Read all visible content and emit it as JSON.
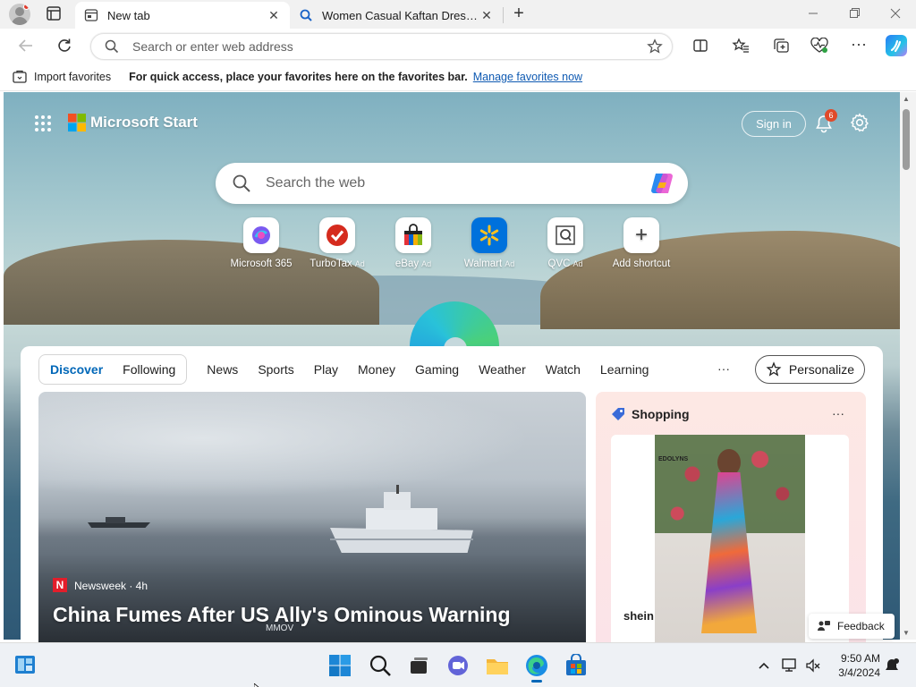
{
  "browser": {
    "tabs": [
      {
        "title": "New tab"
      },
      {
        "title": "Women Casual Kaftan Dress Sho"
      }
    ],
    "address_placeholder": "Search or enter web address",
    "favorites_bar": {
      "import": "Import favorites",
      "hint": "For quick access, place your favorites here on the favorites bar.",
      "manage": "Manage favorites now"
    }
  },
  "ntp": {
    "brand": "Microsoft Start",
    "sign_in": "Sign in",
    "notification_count": "6",
    "search_placeholder": "Search the web",
    "quick_links": [
      {
        "label": "Microsoft 365",
        "ad": ""
      },
      {
        "label": "TurboTax",
        "ad": "Ad"
      },
      {
        "label": "eBay",
        "ad": "Ad"
      },
      {
        "label": "Walmart",
        "ad": "Ad"
      },
      {
        "label": "QVC",
        "ad": "Ad"
      },
      {
        "label": "Add shortcut",
        "ad": ""
      }
    ],
    "tabs": {
      "discover": "Discover",
      "following": "Following",
      "items": [
        "News",
        "Sports",
        "Play",
        "Money",
        "Gaming",
        "Weather",
        "Watch",
        "Learning"
      ],
      "more": "···",
      "personalize": "Personalize"
    },
    "hero": {
      "source": "Newsweek · 4h",
      "headline": "China Fumes After US Ally's Ominous Warning",
      "image_caption": "MMOV"
    },
    "shopping": {
      "title": "Shopping",
      "more": "···",
      "brand": "shein",
      "image_text": "EDOLYNS"
    },
    "feedback": "Feedback"
  },
  "taskbar": {
    "time": "9:50 AM",
    "date": "3/4/2024"
  },
  "colors": {
    "accent": "#0067b8",
    "badge": "#e04a2a",
    "link": "#0f5ab2"
  }
}
